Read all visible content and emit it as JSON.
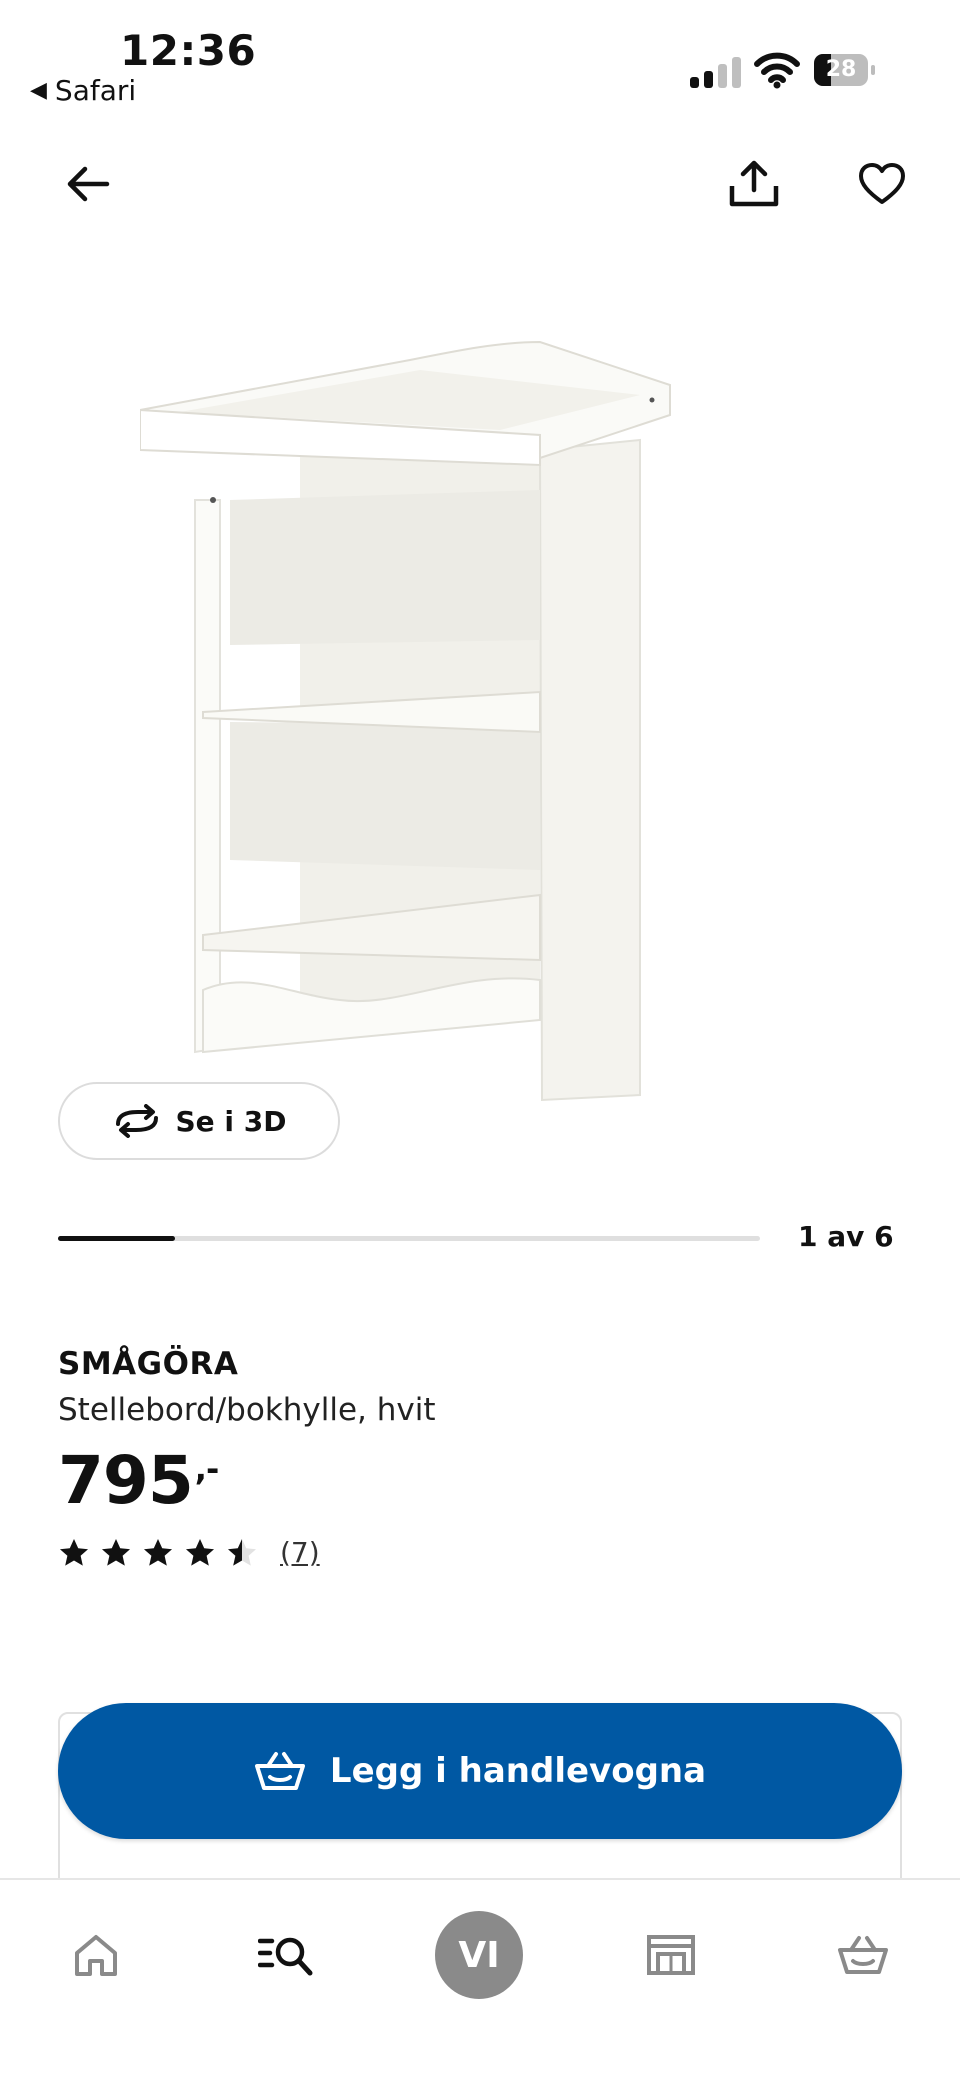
{
  "status_bar": {
    "time": "12:36",
    "back_app": "Safari",
    "battery": "28",
    "signal_bars_active": 2,
    "signal_bars_total": 4
  },
  "nav": {
    "back_icon": "arrow-left-icon",
    "share_icon": "share-icon",
    "favorite_icon": "heart-icon"
  },
  "media": {
    "view_3d_label": "Se i 3D",
    "view_3d_icon": "rotate-arrows-icon",
    "image_index": 1,
    "image_total": 6,
    "counter_label": "1 av 6"
  },
  "product": {
    "name": "SMÅGÖRA",
    "description": "Stellebord/bokhylle, hvit",
    "price": "795",
    "price_suffix": ",-",
    "rating": 4.5,
    "rating_max": 5,
    "review_count": "(7)"
  },
  "availability": {
    "status_color": "#0a8a00"
  },
  "cta": {
    "label": "Legg i handlevogna",
    "icon": "shopping-basket-icon",
    "color": "#0058a3"
  },
  "tabbar": {
    "items": [
      {
        "name": "home",
        "icon": "home-icon"
      },
      {
        "name": "search",
        "icon": "search-list-icon"
      },
      {
        "name": "profile",
        "initials": "VI"
      },
      {
        "name": "store",
        "icon": "store-icon"
      },
      {
        "name": "cart",
        "icon": "basket-icon"
      }
    ]
  }
}
